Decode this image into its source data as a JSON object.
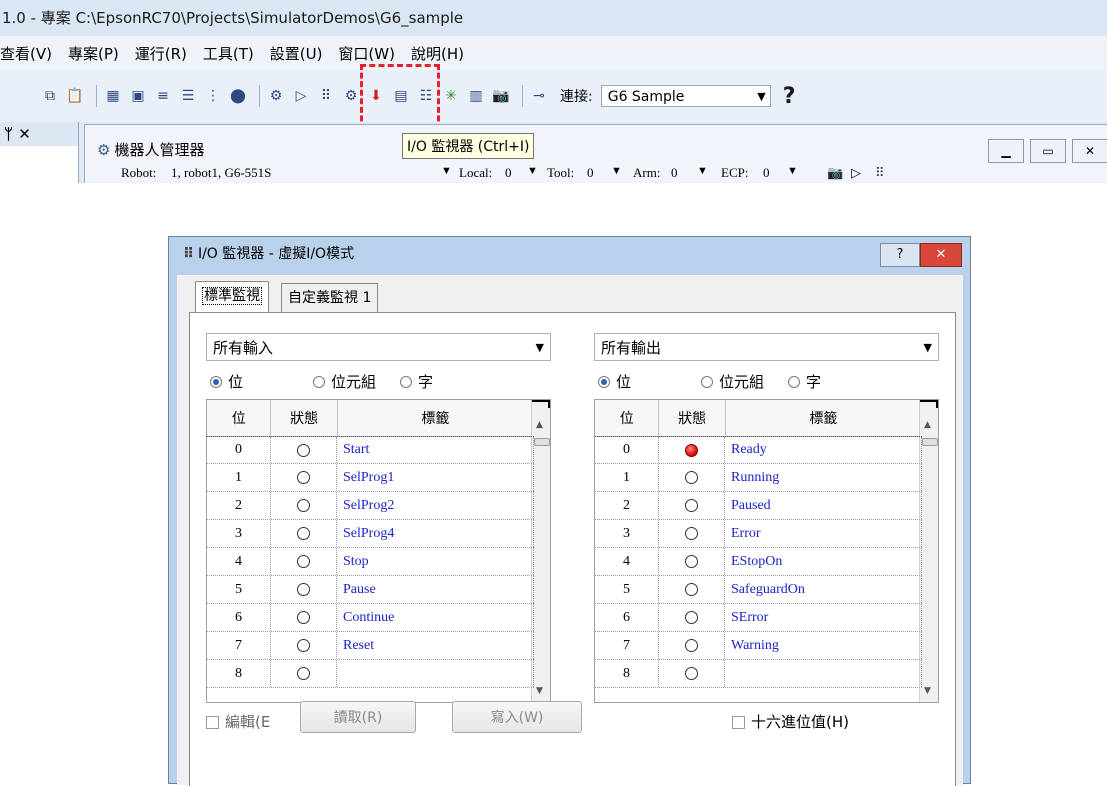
{
  "ide": {
    "title": "1.0 - 專案 C:\\EpsonRC70\\Projects\\SimulatorDemos\\G6_sample",
    "menu": [
      "查看(V)",
      "專案(P)",
      "運行(R)",
      "工具(T)",
      "設置(U)",
      "窗口(W)",
      "說明(H)"
    ],
    "connect_label": "連接:",
    "connect_value": "G6 Sample",
    "help_glyph": "?",
    "tooltip": "I/O 監視器 (Ctrl+I)",
    "left_panel_head": "ᛘ ✕"
  },
  "robot_manager": {
    "title": "機器人管理器",
    "robot_label": "Robot:",
    "robot_value": "1, robot1, G6-551S",
    "local_label": "Local:",
    "local_value": "0",
    "tool_label": "Tool:",
    "tool_value": "0",
    "arm_label": "Arm:",
    "arm_value": "0",
    "ecp_label": "ECP:",
    "ecp_value": "0"
  },
  "dialog": {
    "title": "I/O 監視器 - 虛擬I/O模式",
    "help": "?",
    "close": "✕",
    "tabs": [
      "標準監視",
      "自定義監視 1"
    ],
    "input_combo": "所有輸入",
    "output_combo": "所有輸出",
    "radio_bit": "位",
    "radio_byte": "位元組",
    "radio_word": "字",
    "col_bit": "位",
    "col_state": "狀態",
    "col_label": "標籤",
    "inputs": [
      {
        "bit": "0",
        "on": false,
        "label": "Start"
      },
      {
        "bit": "1",
        "on": false,
        "label": "SelProg1"
      },
      {
        "bit": "2",
        "on": false,
        "label": "SelProg2"
      },
      {
        "bit": "3",
        "on": false,
        "label": "SelProg4"
      },
      {
        "bit": "4",
        "on": false,
        "label": "Stop"
      },
      {
        "bit": "5",
        "on": false,
        "label": "Pause"
      },
      {
        "bit": "6",
        "on": false,
        "label": "Continue"
      },
      {
        "bit": "7",
        "on": false,
        "label": "Reset"
      },
      {
        "bit": "8",
        "on": false,
        "label": ""
      }
    ],
    "outputs": [
      {
        "bit": "0",
        "on": true,
        "label": "Ready"
      },
      {
        "bit": "1",
        "on": false,
        "label": "Running"
      },
      {
        "bit": "2",
        "on": false,
        "label": "Paused"
      },
      {
        "bit": "3",
        "on": false,
        "label": "Error"
      },
      {
        "bit": "4",
        "on": false,
        "label": "EStopOn"
      },
      {
        "bit": "5",
        "on": false,
        "label": "SafeguardOn"
      },
      {
        "bit": "6",
        "on": false,
        "label": "SError"
      },
      {
        "bit": "7",
        "on": false,
        "label": "Warning"
      },
      {
        "bit": "8",
        "on": false,
        "label": ""
      }
    ],
    "edit_label": "編輯(E",
    "read_button": "讀取(R)",
    "write_button": "寫入(W)",
    "hex_label": "十六進位值(H)"
  }
}
